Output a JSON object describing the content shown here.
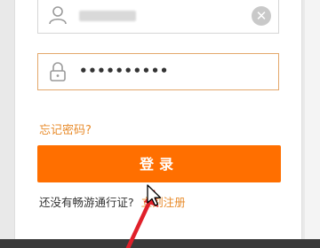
{
  "login": {
    "username_value": "",
    "password_value": "••••••••••",
    "forgot_label": "忘记密码?",
    "login_label": "登录",
    "no_account_text": "还没有畅游通行证?",
    "register_label": "立刻注册"
  },
  "icons": {
    "user": "user-icon",
    "lock": "lock-icon",
    "clear": "clear-icon",
    "cursor": "mouse-pointer-icon",
    "arrow": "red-arrow-annotation"
  },
  "colors": {
    "accent": "#ff6f00",
    "link": "#e88b2b",
    "field_focus_border": "#e3a76a",
    "annotation": "#e0202a"
  }
}
